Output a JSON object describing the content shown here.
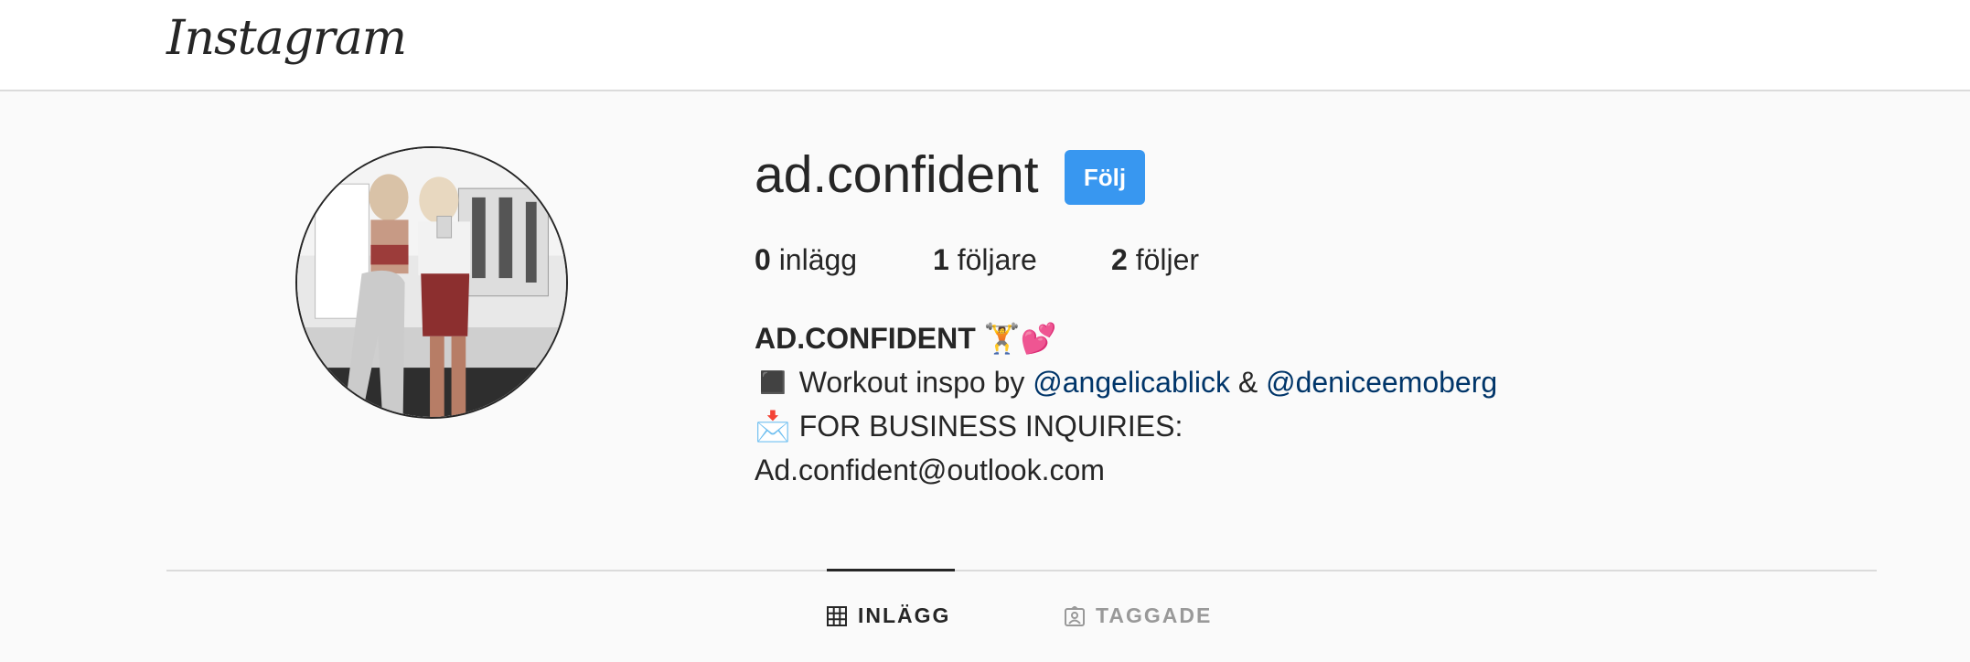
{
  "header": {
    "logo_text": "Instagram"
  },
  "profile": {
    "username": "ad.confident",
    "follow_label": "Följ",
    "stats": [
      {
        "count": "0",
        "label": "inlägg"
      },
      {
        "count": "1",
        "label": "följare"
      },
      {
        "count": "2",
        "label": "följer"
      }
    ],
    "bio": {
      "name": "AD.CONFIDENT",
      "name_emoji": "🏋️💕",
      "line1_prefix_icon": "◼️",
      "line1_text": "Workout inspo by",
      "mention1": "@angelicablick",
      "amp": "&",
      "mention2": "@deniceemoberg",
      "line2_icon": "📩",
      "line2_text": "FOR BUSINESS INQUIRIES:",
      "line3_text": "Ad.confident@outlook.com"
    }
  },
  "tabs": [
    {
      "label": "INLÄGG",
      "icon": "grid-icon",
      "active": true
    },
    {
      "label": "TAGGADE",
      "icon": "tagged-icon",
      "active": false
    }
  ],
  "colors": {
    "accent": "#3897f0",
    "link": "#003569",
    "text": "#262626",
    "muted": "#999999",
    "background": "#fafafa"
  }
}
